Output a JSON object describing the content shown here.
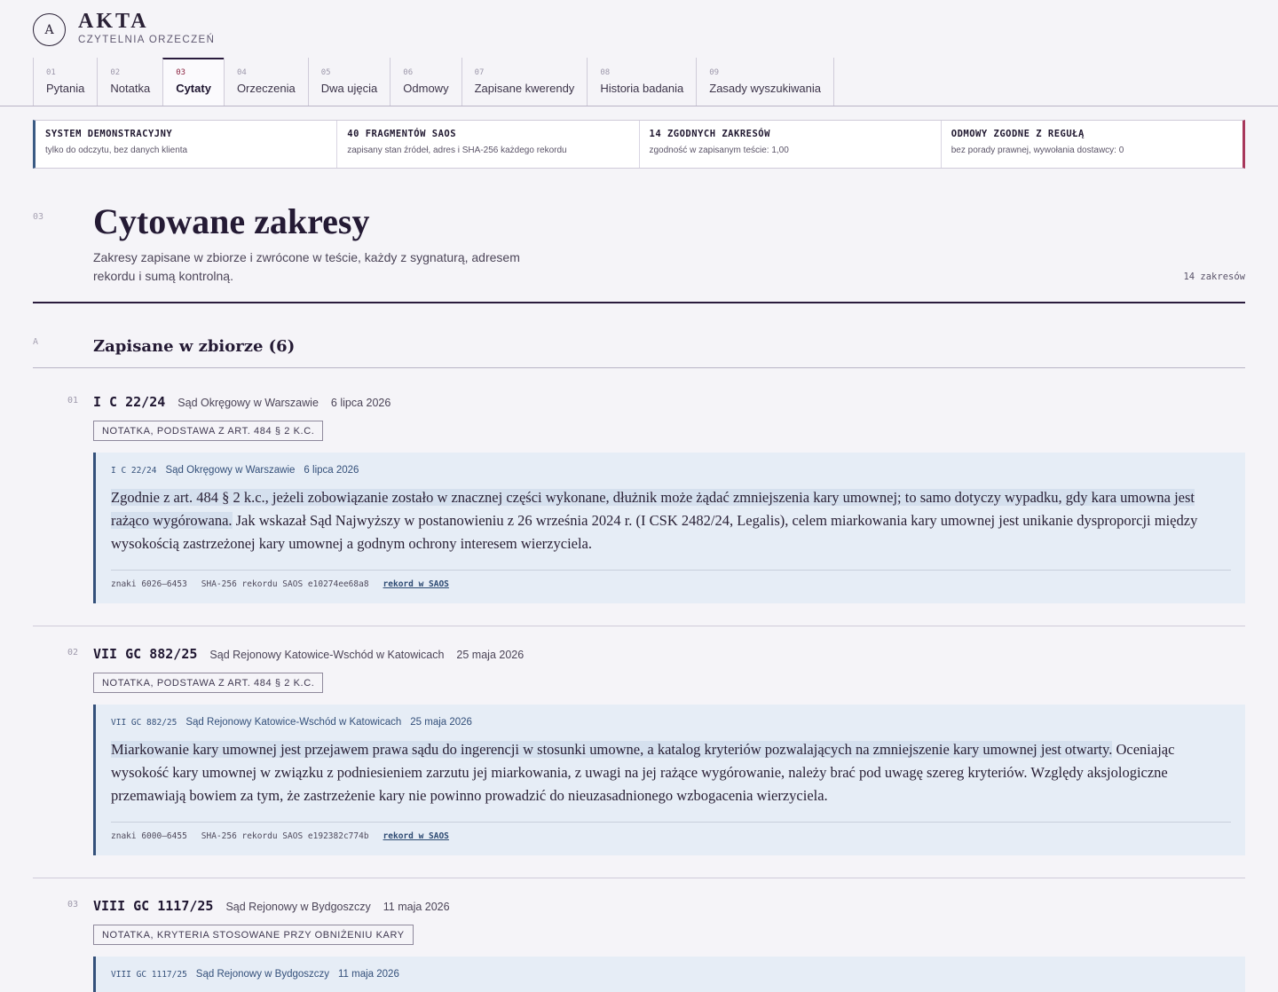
{
  "brand": {
    "mark": "A",
    "name": "AKTA",
    "subtitle": "CZYTELNIA ORZECZEŃ"
  },
  "tabs": [
    {
      "num": "01",
      "label": "Pytania",
      "active": false
    },
    {
      "num": "02",
      "label": "Notatka",
      "active": false
    },
    {
      "num": "03",
      "label": "Cytaty",
      "active": true
    },
    {
      "num": "04",
      "label": "Orzeczenia",
      "active": false
    },
    {
      "num": "05",
      "label": "Dwa ujęcia",
      "active": false
    },
    {
      "num": "06",
      "label": "Odmowy",
      "active": false
    },
    {
      "num": "07",
      "label": "Zapisane kwerendy",
      "active": false
    },
    {
      "num": "08",
      "label": "Historia badania",
      "active": false
    },
    {
      "num": "09",
      "label": "Zasady wyszukiwania",
      "active": false
    }
  ],
  "status": [
    {
      "title": "SYSTEM DEMONSTRACYJNY",
      "desc": "tylko do odczytu, bez danych klienta"
    },
    {
      "title": "40 FRAGMENTÓW SAOS",
      "desc": "zapisany stan źródeł, adres i SHA-256 każdego rekordu"
    },
    {
      "title": "14 ZGODNYCH ZAKRESÓW",
      "desc": "zgodność w zapisanym teście: 1,00"
    },
    {
      "title": "ODMOWY ZGODNE Z REGUŁĄ",
      "desc": "bez porady prawnej, wywołania dostawcy: 0"
    }
  ],
  "page": {
    "num": "03",
    "title": "Cytowane zakresy",
    "desc": "Zakresy zapisane w zbiorze i zwrócone w teście, każdy z sygnaturą, adresem rekordu i sumą kontrolną.",
    "count": "14 zakresów"
  },
  "section": {
    "letter": "A",
    "title": "Zapisane w zbiorze (6)"
  },
  "entries": [
    {
      "num": "01",
      "sig": "I C 22/24",
      "court": "Sąd Okręgowy w Warszawie",
      "date": "6 lipca 2026",
      "tag": "NOTATKA, PODSTAWA Z ART. 484 § 2 K.C.",
      "quote_highlight": "Zgodnie z art. 484 § 2 k.c., jeżeli zobowiązanie zostało w znacznej części wykonane, dłużnik może żądać zmniejszenia kary umownej; to samo dotyczy wypadku, gdy kara umowna jest rażąco wygórowana.",
      "quote_rest": " Jak wskazał Sąd Najwyższy w postanowieniu z 26 września 2024 r. (I CSK 2482/24, Legalis), celem miarkowania kary umownej jest unikanie dysproporcji między wysokością zastrzeżonej kary umownej a godnym ochrony interesem wierzyciela.",
      "chars": "znaki 6026–6453",
      "sha": "SHA-256 rekordu SAOS e10274ee68a8",
      "link": "rekord w SAOS"
    },
    {
      "num": "02",
      "sig": "VII GC 882/25",
      "court": "Sąd Rejonowy Katowice-Wschód w Katowicach",
      "date": "25 maja 2026",
      "tag": "NOTATKA, PODSTAWA Z ART. 484 § 2 K.C.",
      "quote_highlight": "Miarkowanie kary umownej jest przejawem prawa sądu do ingerencji w stosunki umowne, a katalog kryteriów pozwalających na zmniejszenie kary umownej jest otwarty.",
      "quote_rest": " Oceniając wysokość kary umownej w związku z podniesieniem zarzutu jej miarkowania, z uwagi na jej rażące wygórowanie, należy brać pod uwagę szereg kryteriów. Względy aksjologiczne przemawiają bowiem za tym, że zastrzeżenie kary nie powinno prowadzić do nieuzasadnionego wzbogacenia wierzyciela.",
      "chars": "znaki 6000–6455",
      "sha": "SHA-256 rekordu SAOS e192382c774b",
      "link": "rekord w SAOS"
    },
    {
      "num": "03",
      "sig": "VIII GC 1117/25",
      "court": "Sąd Rejonowy w Bydgoszczy",
      "date": "11 maja 2026",
      "tag": "NOTATKA, KRYTERIA STOSOWANE PRZY OBNIŻENIU KARY",
      "quote_highlight": "",
      "quote_rest": "",
      "chars": "",
      "sha": "",
      "link": ""
    }
  ]
}
